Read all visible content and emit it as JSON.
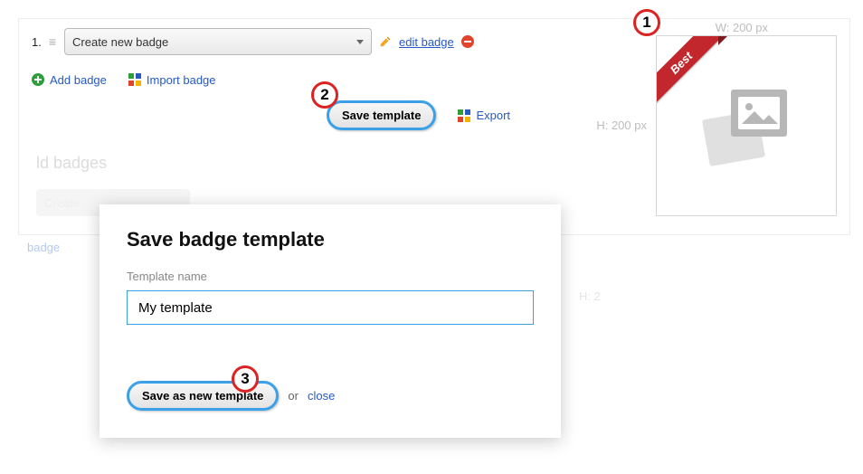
{
  "row1": {
    "index": "1.",
    "dropdown": "Create new badge",
    "edit_label": "edit badge"
  },
  "row2": {
    "add_label": "Add badge",
    "import_label": "Import badge"
  },
  "center": {
    "save_template": "Save template",
    "export": "Export"
  },
  "preview": {
    "width_label": "W: 200 px",
    "height_label": "H: 200 px",
    "ribbon": "Best"
  },
  "faded": {
    "header": "ld badges",
    "ghost": "Create",
    "link": "badge",
    "h2": "H: 2"
  },
  "modal": {
    "title": "Save badge template",
    "field_label": "Template name",
    "value": "My template",
    "save_btn": "Save as new template",
    "or": "or",
    "close": "close"
  },
  "callouts": {
    "one": "1",
    "two": "2",
    "three": "3"
  }
}
